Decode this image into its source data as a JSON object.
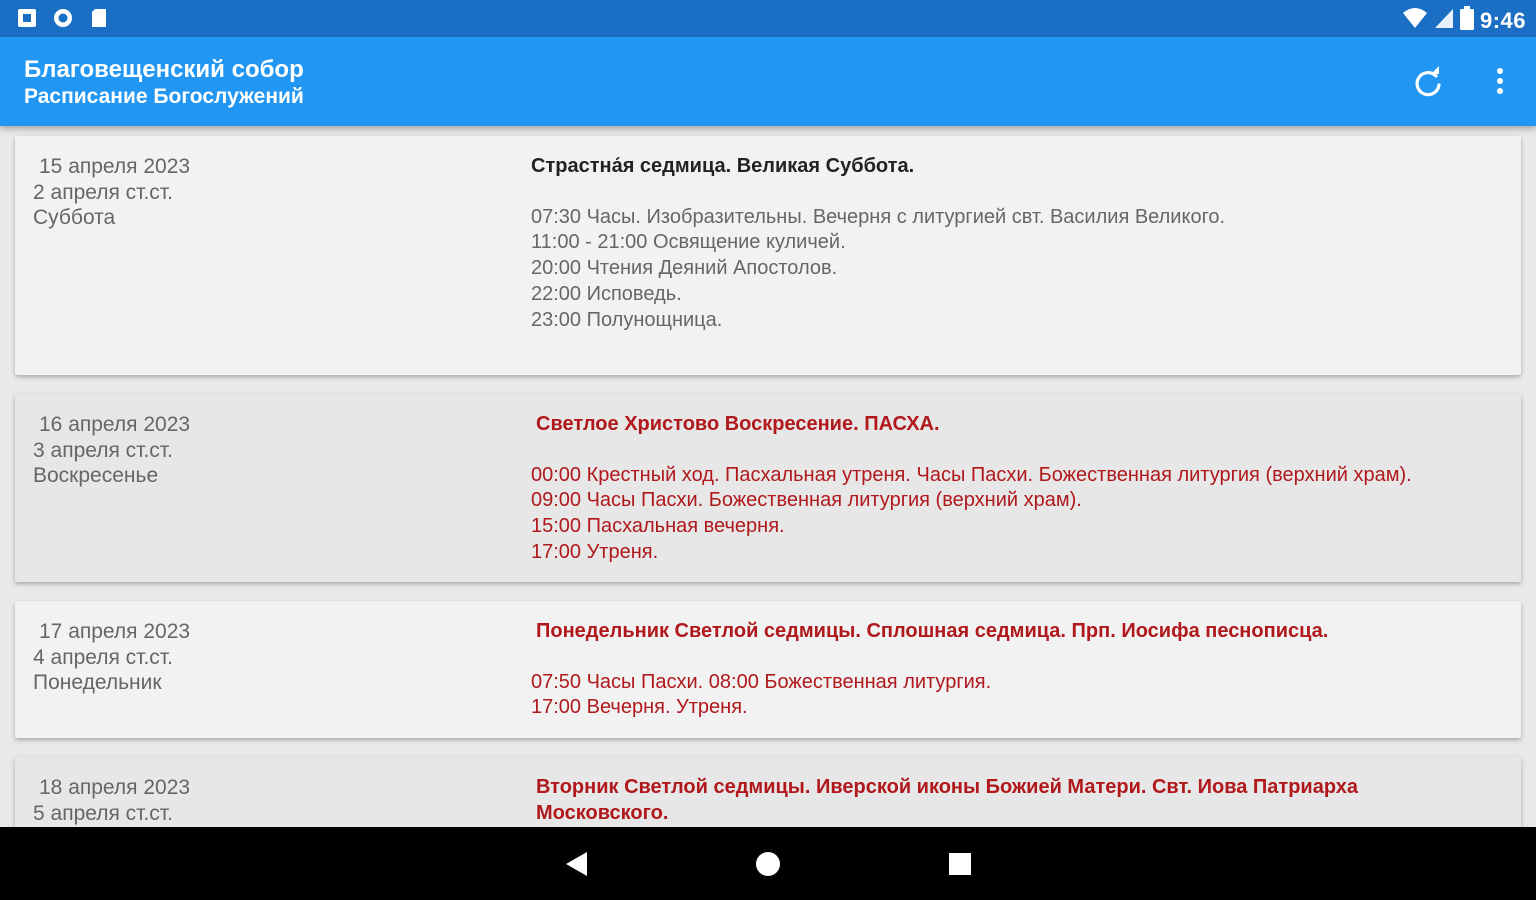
{
  "status_bar": {
    "time": "9:46",
    "left_icons": [
      "notification-square-icon",
      "circle-status-icon",
      "sd-card-icon"
    ],
    "right_icons": [
      "wifi-icon",
      "cell-signal-icon",
      "battery-icon"
    ]
  },
  "app_bar": {
    "title": "Благовещенский собор",
    "subtitle": "Расписание Богослужений",
    "actions": [
      "refresh-icon",
      "more-vert-icon"
    ]
  },
  "colors": {
    "status_bar": "#1a6fc4",
    "app_bar": "#2196f3",
    "feast_red": "#b0181c",
    "date_gray": "#666666"
  },
  "schedule": [
    {
      "date": "15 апреля 2023",
      "old_style": "2 апреля ст.ст.",
      "weekday": "Суббота",
      "title": "Страстна́я седмица. Великая Суббота.",
      "services": [
        "07:30 Часы. Изобразительны. Вечерня с литургией свт. Василия Великого.",
        "11:00 - 21:00 Освящение куличей.",
        "20:00 Чтения Деяний Апостолов.",
        "22:00 Исповедь.",
        "23:00 Полунощница."
      ]
    },
    {
      "date": "16 апреля 2023",
      "old_style": "3 апреля ст.ст.",
      "weekday": "Воскресенье",
      "title": "Светлое Христово Воскресение. ПАСХА.",
      "services": [
        "00:00 Крестный ход. Пасхальная утреня. Часы Пасхи. Божественная литургия (верхний храм).",
        "09:00 Часы Пасхи. Божественная литургия (верхний храм).",
        "15:00 Пасхальная вечерня.",
        "17:00 Утреня."
      ]
    },
    {
      "date": "17 апреля 2023",
      "old_style": "4 апреля ст.ст.",
      "weekday": "Понедельник",
      "title": "Понедельник Светлой седмицы. Сплошная седмица. Прп. Иосифа песнописца.",
      "services": [
        "07:50 Часы Пасхи. 08:00 Божественная литургия.",
        "17:00 Вечерня. Утреня."
      ]
    },
    {
      "date": "18 апреля 2023",
      "old_style": "5 апреля ст.ст.",
      "weekday": "",
      "title": "Вторник Светлой седмицы. Иверской иконы Божией Матери. Свт. Иова Патриарха Московского.",
      "services": []
    }
  ],
  "nav_bar": [
    "back-icon",
    "home-icon",
    "recents-icon"
  ]
}
